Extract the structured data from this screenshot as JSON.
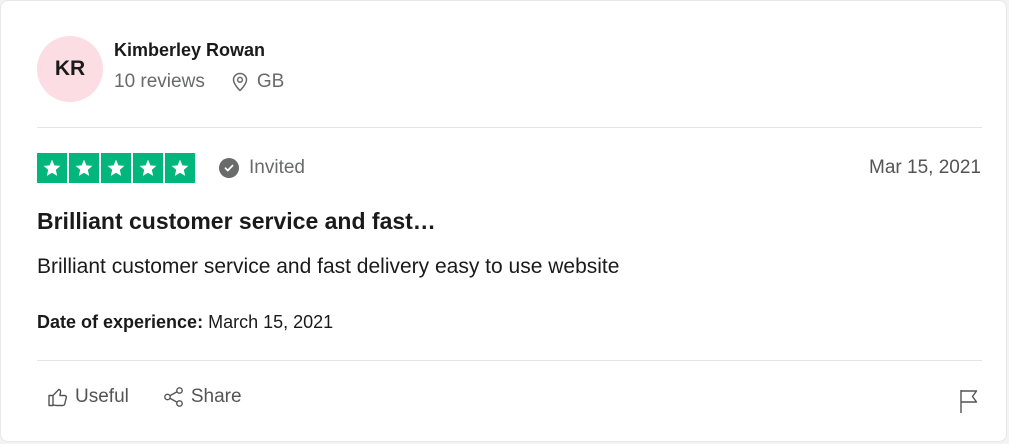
{
  "review": {
    "consumer": {
      "initials": "KR",
      "name": "Kimberley Rowan",
      "reviews_count": "10 reviews",
      "location": "GB",
      "avatar_color": "#fcdde4"
    },
    "rating": {
      "stars": 5,
      "max_stars": 5,
      "star_color": "#00b67a"
    },
    "invited_label": "Invited",
    "date": "Mar 15, 2021",
    "title": "Brilliant customer service and fast…",
    "text": "Brilliant customer service and fast delivery easy to use website",
    "experience": {
      "label": "Date of experience:",
      "value": "March 15, 2021"
    },
    "actions": {
      "useful_label": "Useful",
      "share_label": "Share"
    },
    "icons": {
      "location": "location-pin-icon",
      "invited": "check-circle-icon",
      "useful": "thumbs-up-icon",
      "share": "share-icon",
      "report": "flag-icon"
    }
  }
}
